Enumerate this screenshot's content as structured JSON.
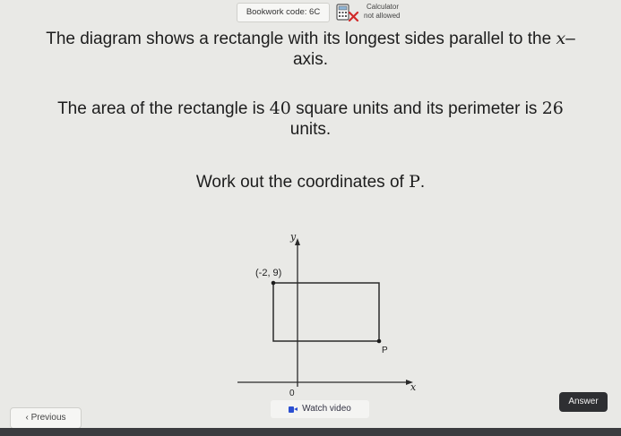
{
  "header": {
    "bookwork_code": "Bookwork code: 6C",
    "calculator_line1": "Calculator",
    "calculator_line2": "not allowed",
    "calculator_icon": "calculator-crossed-icon"
  },
  "question": {
    "line1_a": "The diagram shows a rectangle with its longest sides parallel to the ",
    "line1_var": "x",
    "line1_b": "–",
    "line2": "axis.",
    "line3_a": "The area of the rectangle is ",
    "area_value": "40",
    "line3_b": " square units and its perimeter is ",
    "perimeter_value": "26",
    "line4": "units.",
    "line5_a": "Work out the coordinates of ",
    "point_name": "P",
    "line5_b": "."
  },
  "diagram": {
    "y_axis_label": "y",
    "x_axis_label": "x",
    "origin_label": "0",
    "corner_label": "(-2, 9)",
    "point_label": "P"
  },
  "footer": {
    "previous_label": "Previous",
    "watch_video_label": "Watch video",
    "answer_label": "Answer"
  },
  "colors": {
    "background": "#e9e9e6",
    "answer_button_bg": "#2e2f32",
    "video_icon": "#2b4fd1"
  }
}
